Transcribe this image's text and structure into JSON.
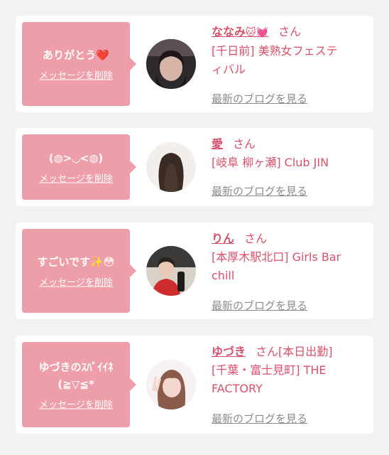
{
  "delete_label": "メッセージを削除",
  "blog_label": "最新のブログを見る",
  "honorific": "さん",
  "colors": {
    "bubble": "#ee9ea9",
    "accent": "#d9506a",
    "link_gray": "#8b8b8b",
    "background": "#f2f2f2"
  },
  "items": [
    {
      "message": "ありがとう",
      "message_emoji": "❤️",
      "name": "ななみ",
      "name_emoji": "🐱💓",
      "shop_line1": "[千日前] 美熟女フェステ",
      "shop_line2": "ィバル"
    },
    {
      "message": "(◍>◡<◍)",
      "name": "愛",
      "shop_line1": "[岐阜 柳ヶ瀬] Club JIN"
    },
    {
      "message": "すごいです",
      "message_emoji": "✨😳",
      "name": "りん",
      "shop_line1": "[本厚木駅北口] Girls Bar",
      "shop_line2": "chill"
    },
    {
      "message_line1": "ゆづきのｽﾊﾟｲｲﾈ",
      "message_line2": "(≧▽≦*",
      "name": "ゆづき",
      "status": "[本日出勤]",
      "shop_line1": "[千葉・富士見町] THE",
      "shop_line2": "FACTORY"
    }
  ]
}
